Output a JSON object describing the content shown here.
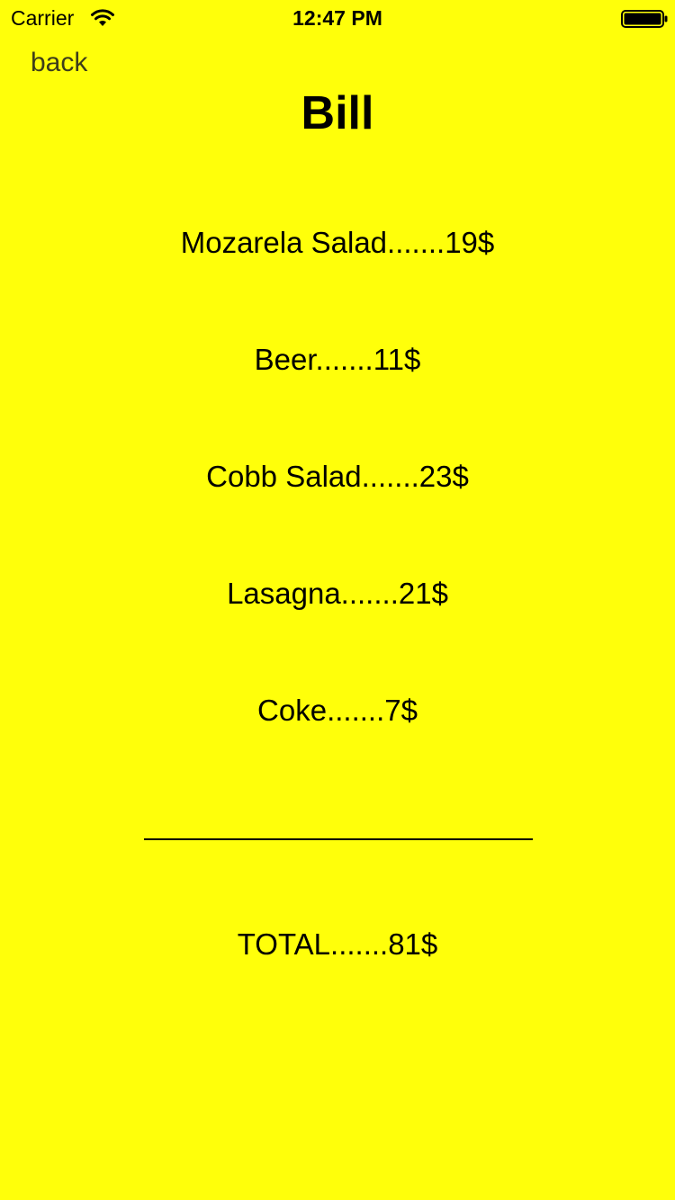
{
  "status_bar": {
    "carrier": "Carrier",
    "time": "12:47 PM",
    "wifi_icon": "wifi-icon",
    "battery_icon": "battery-full-icon"
  },
  "nav": {
    "back_label": "back"
  },
  "title": "Bill",
  "items": [
    {
      "label": "Mozarela Salad.......19$"
    },
    {
      "label": "Beer.......11$"
    },
    {
      "label": "Cobb Salad.......23$"
    },
    {
      "label": "Lasagna.......21$"
    },
    {
      "label": "Coke.......7$"
    }
  ],
  "total": "TOTAL.......81$",
  "colors": {
    "background": "#FFFF0A",
    "text": "#000000",
    "back_text": "#3D3D1A"
  }
}
